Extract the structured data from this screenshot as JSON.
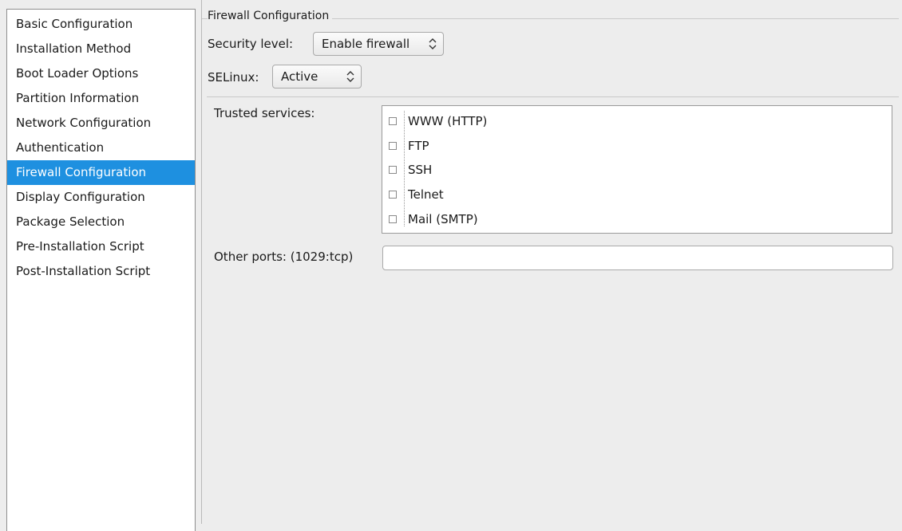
{
  "sidebar": {
    "items": [
      {
        "label": "Basic Configuration"
      },
      {
        "label": "Installation Method"
      },
      {
        "label": "Boot Loader Options"
      },
      {
        "label": "Partition Information"
      },
      {
        "label": "Network Configuration"
      },
      {
        "label": "Authentication"
      },
      {
        "label": "Firewall Configuration",
        "selected": true
      },
      {
        "label": "Display Configuration"
      },
      {
        "label": "Package Selection"
      },
      {
        "label": "Pre-Installation Script"
      },
      {
        "label": "Post-Installation Script"
      }
    ],
    "selected_color": "#1e90e0"
  },
  "firewall": {
    "frame_title": "Firewall Configuration",
    "security_level_label": "Security level:",
    "security_level_value": "Enable firewall",
    "selinux_label": "SELinux:",
    "selinux_value": "Active",
    "trusted_services_label": "Trusted services:",
    "services": [
      {
        "label": "WWW (HTTP)",
        "checked": false
      },
      {
        "label": "FTP",
        "checked": false
      },
      {
        "label": "SSH",
        "checked": false
      },
      {
        "label": "Telnet",
        "checked": false
      },
      {
        "label": "Mail (SMTP)",
        "checked": false
      }
    ],
    "other_ports_label": "Other ports: (1029:tcp)",
    "other_ports_value": ""
  },
  "icons": {
    "combo_arrows": "up-down-chevron-icon",
    "checkbox": "checkbox-unchecked-icon"
  }
}
